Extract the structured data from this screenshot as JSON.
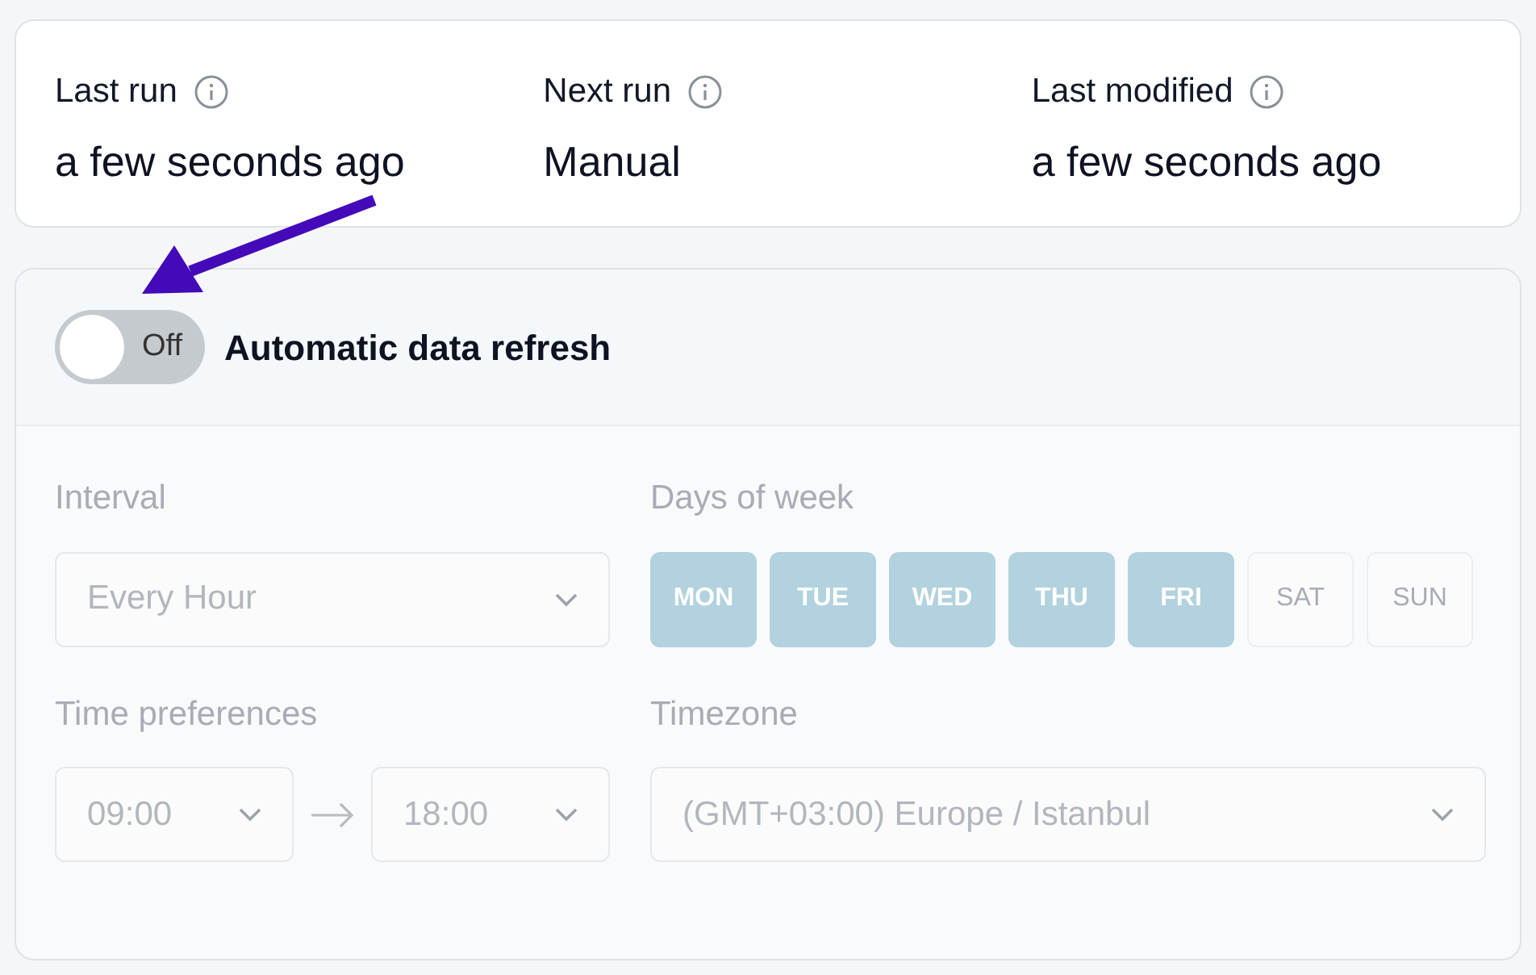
{
  "stats": [
    {
      "label": "Last run",
      "value": "a few seconds ago"
    },
    {
      "label": "Next run",
      "value": "Manual"
    },
    {
      "label": "Last modified",
      "value": "a few seconds ago"
    }
  ],
  "refresh": {
    "on": false,
    "toggle_text": "Off",
    "title": "Automatic data refresh"
  },
  "form": {
    "disabled": true,
    "interval": {
      "label": "Interval",
      "value": "Every Hour"
    },
    "days": {
      "label": "Days of week",
      "items": [
        {
          "label": "MON",
          "selected": true
        },
        {
          "label": "TUE",
          "selected": true
        },
        {
          "label": "WED",
          "selected": true
        },
        {
          "label": "THU",
          "selected": true
        },
        {
          "label": "FRI",
          "selected": true
        },
        {
          "label": "SAT",
          "selected": false
        },
        {
          "label": "SUN",
          "selected": false
        }
      ]
    },
    "time": {
      "label": "Time preferences",
      "start": "09:00",
      "end": "18:00"
    },
    "timezone": {
      "label": "Timezone",
      "value": "(GMT+03:00) Europe / Istanbul"
    }
  },
  "annotation": {
    "kind": "arrow"
  }
}
